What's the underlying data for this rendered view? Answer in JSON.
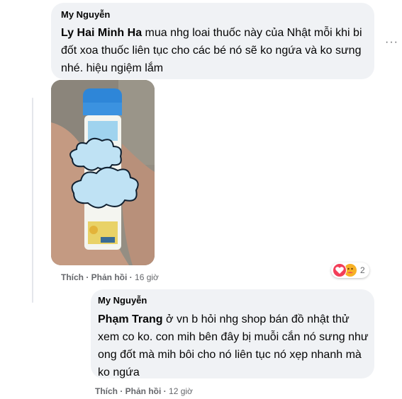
{
  "comment1": {
    "author": "My Nguyễn",
    "tag": "Ly Hai Minh Ha",
    "text": " mua nhg loai thuốc này của Nhật mỗi khi bi đốt xoa thuốc liên tục cho các bé nó sẽ ko ngứa và ko sưng nhé. hiệu ngiệm lắm",
    "like": "Thích",
    "reply": "Phản hồi",
    "time": "16 giờ",
    "sep": " · ",
    "reaction_count": "2",
    "reaction_icons": [
      "heart-icon",
      "care-icon"
    ]
  },
  "comment2": {
    "author": "My Nguyễn",
    "tag": "Phạm Trang",
    "text": " ở vn b hỏi nhg shop bán đồ nhật thử xem co ko. con mih bên đây bị muỗi cắn nó sưng như ong đốt mà mih bôi cho nó liên tục nó xẹp nhanh mà ko ngứa",
    "like": "Thích",
    "reply": "Phản hồi",
    "time": "12 giờ",
    "sep": " · "
  },
  "more_menu": "···",
  "colors": {
    "bubble": "#f0f2f5",
    "meta": "#65676b",
    "bottle": "#2e86d8",
    "heart": "#f33e58",
    "care": "#f7b125"
  }
}
